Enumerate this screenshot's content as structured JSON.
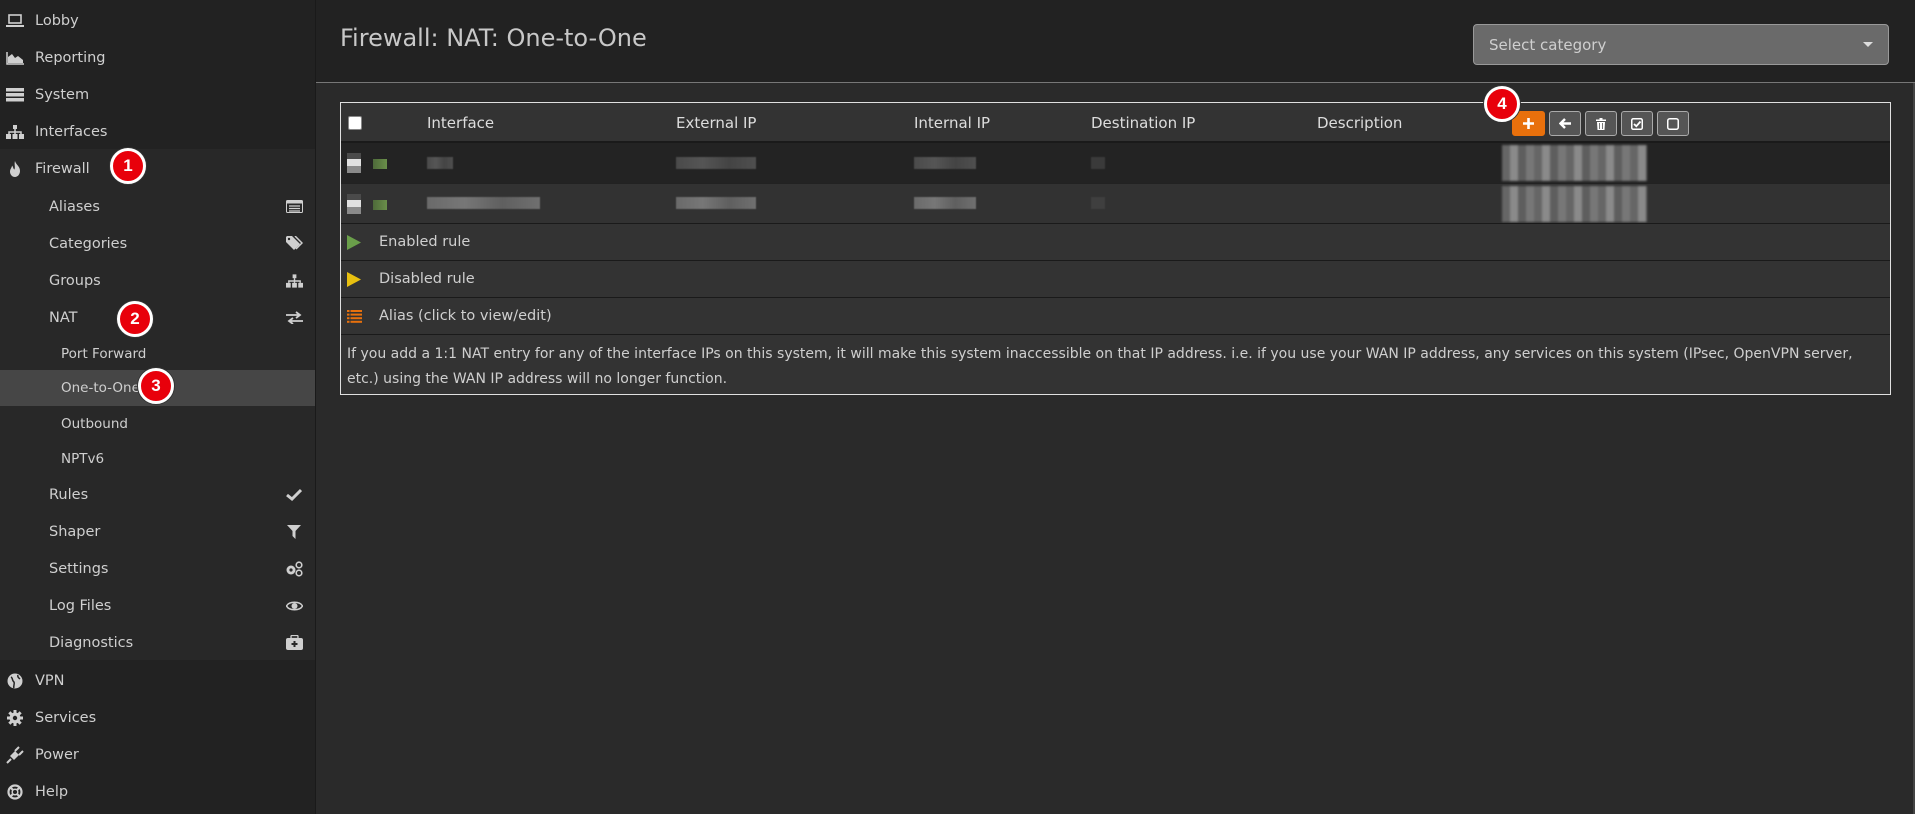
{
  "sidebar": {
    "top_items": [
      {
        "label": "Lobby",
        "icon": "laptop-icon"
      },
      {
        "label": "Reporting",
        "icon": "area-chart-icon"
      },
      {
        "label": "System",
        "icon": "server-icon"
      },
      {
        "label": "Interfaces",
        "icon": "sitemap-icon"
      },
      {
        "label": "Firewall",
        "icon": "fire-icon"
      }
    ],
    "firewall_items": [
      {
        "label": "Aliases",
        "icon": "list-alt-icon"
      },
      {
        "label": "Categories",
        "icon": "tags-icon"
      },
      {
        "label": "Groups",
        "icon": "sitemap-icon"
      },
      {
        "label": "NAT",
        "icon": "exchange-icon"
      }
    ],
    "nat_items": [
      {
        "label": "Port Forward"
      },
      {
        "label": "One-to-One",
        "active": true
      },
      {
        "label": "Outbound"
      },
      {
        "label": "NPTv6"
      }
    ],
    "firewall_items_2": [
      {
        "label": "Rules",
        "icon": "check-icon"
      },
      {
        "label": "Shaper",
        "icon": "filter-icon"
      },
      {
        "label": "Settings",
        "icon": "cogs-icon"
      },
      {
        "label": "Log Files",
        "icon": "eye-icon"
      },
      {
        "label": "Diagnostics",
        "icon": "medkit-icon"
      }
    ],
    "bottom_items": [
      {
        "label": "VPN",
        "icon": "globe-icon"
      },
      {
        "label": "Services",
        "icon": "cog-icon"
      },
      {
        "label": "Power",
        "icon": "plug-icon"
      },
      {
        "label": "Help",
        "icon": "life-ring-icon"
      }
    ]
  },
  "header": {
    "title": "Firewall: NAT: One-to-One",
    "category_select": {
      "placeholder": "Select category"
    }
  },
  "table": {
    "columns": [
      "Interface",
      "External IP",
      "Internal IP",
      "Destination IP",
      "Description"
    ],
    "toolbar": {
      "add": "add-icon",
      "move": "arrow-left-icon",
      "delete": "trash-icon",
      "enable": "check-square-icon",
      "disable": "square-icon"
    },
    "rows": [
      {
        "interface": "[redacted]",
        "external_ip": "[redacted]",
        "internal_ip": "[redacted]",
        "destination_ip": "[redacted]",
        "description": "[redacted]"
      },
      {
        "interface": "[redacted]",
        "external_ip": "[redacted]",
        "internal_ip": "[redacted]",
        "destination_ip": "[redacted]",
        "description": "[redacted]"
      }
    ],
    "legend": [
      {
        "label": "Enabled rule",
        "color": "#6a9f4a"
      },
      {
        "label": "Disabled rule",
        "color": "#e8c010"
      },
      {
        "label": "Alias (click to view/edit)",
        "color": "#e8700c"
      }
    ],
    "note": "If you add a 1:1 NAT entry for any of the interface IPs on this system, it will make this system inaccessible on that IP address. i.e. if you use your WAN IP address, any services on this system (IPsec, OpenVPN server, etc.) using the WAN IP address will no longer function."
  },
  "annotations": [
    "1",
    "2",
    "3",
    "4"
  ],
  "colors": {
    "accent": "#e8700c",
    "badge": "#e8000b",
    "sidebar_bg": "#222222",
    "active_bg": "#464646"
  }
}
